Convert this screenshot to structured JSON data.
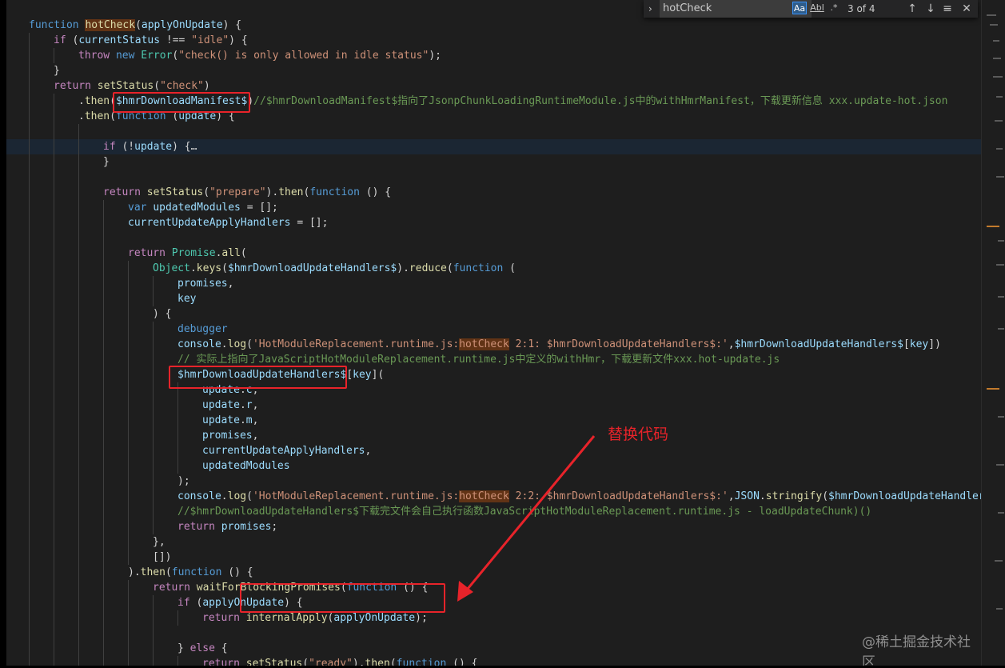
{
  "find_widget": {
    "query": "hotCheck",
    "match_case_label": "Aa",
    "whole_word_label": "Abl",
    "regex_label": ".*",
    "match_count": "3 of 4",
    "prev_icon": "arrow-up-icon",
    "next_icon": "arrow-down-icon",
    "selection_icon": "find-in-selection-icon",
    "close_icon": "close-icon"
  },
  "annotation": {
    "label": "替换代码",
    "color": "#e8232a"
  },
  "watermark": "@稀土掘金技术社区",
  "colors": {
    "editor_bg": "#1e1e1e",
    "keyword": "#569cd6",
    "control": "#c586c0",
    "function": "#dcdcaa",
    "variable": "#9cdcfe",
    "string": "#ce9178",
    "type": "#4ec9b0",
    "comment": "#6a9955",
    "find_highlight": "#613315",
    "annotation_red": "#e8232a"
  },
  "code_lines": [
    {
      "indent": 0,
      "tokens": [
        [
          "kw",
          "function "
        ],
        [
          "fn hl",
          "hotCheck"
        ],
        [
          "pun",
          "("
        ],
        [
          "var",
          "applyOnUpdate"
        ],
        [
          "pun",
          ") {"
        ]
      ]
    },
    {
      "indent": 1,
      "tokens": [
        [
          "ctl",
          "if "
        ],
        [
          "pun",
          "("
        ],
        [
          "var",
          "currentStatus"
        ],
        [
          "pun",
          " !== "
        ],
        [
          "str",
          "\"idle\""
        ],
        [
          "pun",
          ") {"
        ]
      ]
    },
    {
      "indent": 2,
      "tokens": [
        [
          "ctl",
          "throw "
        ],
        [
          "kw",
          "new "
        ],
        [
          "cls",
          "Error"
        ],
        [
          "pun",
          "("
        ],
        [
          "str",
          "\"check() is only allowed in idle status\""
        ],
        [
          "pun",
          ");"
        ]
      ]
    },
    {
      "indent": 1,
      "tokens": [
        [
          "pun",
          "}"
        ]
      ]
    },
    {
      "indent": 1,
      "tokens": [
        [
          "ctl",
          "return "
        ],
        [
          "fn",
          "setStatus"
        ],
        [
          "pun",
          "("
        ],
        [
          "str",
          "\"check\""
        ],
        [
          "pun",
          ")"
        ]
      ]
    },
    {
      "indent": 2,
      "tokens": [
        [
          "pun",
          "."
        ],
        [
          "fn",
          "then"
        ],
        [
          "pun",
          "("
        ],
        [
          "var",
          "$hmrDownloadManifest$"
        ],
        [
          "pun",
          ")"
        ],
        [
          "cmt",
          "//$hmrDownloadManifest$指向了JsonpChunkLoadingRuntimeModule.js中的withHmrManifest，下载更新信息 xxx.update-hot.json"
        ]
      ]
    },
    {
      "indent": 2,
      "tokens": [
        [
          "pun",
          "."
        ],
        [
          "fn",
          "then"
        ],
        [
          "pun",
          "("
        ],
        [
          "kw",
          "function "
        ],
        [
          "pun",
          "("
        ],
        [
          "var",
          "update"
        ],
        [
          "pun",
          ") {"
        ]
      ]
    },
    {
      "indent": 3,
      "tokens": []
    },
    {
      "indent": 3,
      "cur": true,
      "tokens": [
        [
          "ctl",
          "if "
        ],
        [
          "pun",
          "(!"
        ],
        [
          "var",
          "update"
        ],
        [
          "pun",
          ") {…"
        ]
      ]
    },
    {
      "indent": 3,
      "tokens": [
        [
          "pun",
          "}"
        ]
      ]
    },
    {
      "indent": 3,
      "tokens": []
    },
    {
      "indent": 3,
      "tokens": [
        [
          "ctl",
          "return "
        ],
        [
          "fn",
          "setStatus"
        ],
        [
          "pun",
          "("
        ],
        [
          "str",
          "\"prepare\""
        ],
        [
          "pun",
          ")."
        ],
        [
          "fn",
          "then"
        ],
        [
          "pun",
          "("
        ],
        [
          "kw",
          "function "
        ],
        [
          "pun",
          "() {"
        ]
      ]
    },
    {
      "indent": 4,
      "tokens": [
        [
          "kw",
          "var "
        ],
        [
          "var",
          "updatedModules"
        ],
        [
          "pun",
          " = [];"
        ]
      ]
    },
    {
      "indent": 4,
      "tokens": [
        [
          "var",
          "currentUpdateApplyHandlers"
        ],
        [
          "pun",
          " = [];"
        ]
      ]
    },
    {
      "indent": 4,
      "tokens": []
    },
    {
      "indent": 4,
      "tokens": [
        [
          "ctl",
          "return "
        ],
        [
          "cls",
          "Promise"
        ],
        [
          "pun",
          "."
        ],
        [
          "fn",
          "all"
        ],
        [
          "pun",
          "("
        ]
      ]
    },
    {
      "indent": 5,
      "tokens": [
        [
          "cls",
          "Object"
        ],
        [
          "pun",
          "."
        ],
        [
          "fn",
          "keys"
        ],
        [
          "pun",
          "("
        ],
        [
          "var",
          "$hmrDownloadUpdateHandlers$"
        ],
        [
          "pun",
          ")."
        ],
        [
          "fn",
          "reduce"
        ],
        [
          "pun",
          "("
        ],
        [
          "kw",
          "function "
        ],
        [
          "pun",
          "("
        ]
      ]
    },
    {
      "indent": 6,
      "tokens": [
        [
          "var",
          "promises"
        ],
        [
          "pun",
          ","
        ]
      ]
    },
    {
      "indent": 6,
      "tokens": [
        [
          "var",
          "key"
        ]
      ]
    },
    {
      "indent": 5,
      "tokens": [
        [
          "pun",
          ") {"
        ]
      ]
    },
    {
      "indent": 6,
      "tokens": [
        [
          "kw",
          "debugger"
        ]
      ]
    },
    {
      "indent": 6,
      "tokens": [
        [
          "var",
          "console"
        ],
        [
          "pun",
          "."
        ],
        [
          "fn",
          "log"
        ],
        [
          "pun",
          "("
        ],
        [
          "str",
          "'HotModuleReplacement.runtime.js:"
        ],
        [
          "str hl",
          "hotCheck"
        ],
        [
          "str",
          " 2:1: $hmrDownloadUpdateHandlers$:'"
        ],
        [
          "pun",
          ","
        ],
        [
          "var",
          "$hmrDownloadUpdateHandlers$"
        ],
        [
          "pun",
          "["
        ],
        [
          "var",
          "key"
        ],
        [
          "pun",
          "])"
        ]
      ]
    },
    {
      "indent": 6,
      "tokens": [
        [
          "cmt",
          "// 实际上指向了JavaScriptHotModuleReplacement.runtime.js中定义的withHmr，下载更新文件xxx.hot-update.js"
        ]
      ]
    },
    {
      "indent": 6,
      "tokens": [
        [
          "var",
          "$hmrDownloadUpdateHandlers$"
        ],
        [
          "pun",
          "["
        ],
        [
          "var",
          "key"
        ],
        [
          "pun",
          "]("
        ]
      ]
    },
    {
      "indent": 7,
      "tokens": [
        [
          "var",
          "update"
        ],
        [
          "pun",
          "."
        ],
        [
          "var",
          "c"
        ],
        [
          "pun",
          ","
        ]
      ]
    },
    {
      "indent": 7,
      "tokens": [
        [
          "var",
          "update"
        ],
        [
          "pun",
          "."
        ],
        [
          "var",
          "r"
        ],
        [
          "pun",
          ","
        ]
      ]
    },
    {
      "indent": 7,
      "tokens": [
        [
          "var",
          "update"
        ],
        [
          "pun",
          "."
        ],
        [
          "var",
          "m"
        ],
        [
          "pun",
          ","
        ]
      ]
    },
    {
      "indent": 7,
      "tokens": [
        [
          "var",
          "promises"
        ],
        [
          "pun",
          ","
        ]
      ]
    },
    {
      "indent": 7,
      "tokens": [
        [
          "var",
          "currentUpdateApplyHandlers"
        ],
        [
          "pun",
          ","
        ]
      ]
    },
    {
      "indent": 7,
      "tokens": [
        [
          "var",
          "updatedModules"
        ]
      ]
    },
    {
      "indent": 6,
      "tokens": [
        [
          "pun",
          ");"
        ]
      ]
    },
    {
      "indent": 6,
      "tokens": [
        [
          "var",
          "console"
        ],
        [
          "pun",
          "."
        ],
        [
          "fn",
          "log"
        ],
        [
          "pun",
          "("
        ],
        [
          "str",
          "'HotModuleReplacement.runtime.js:"
        ],
        [
          "str hl",
          "hotCheck"
        ],
        [
          "str",
          " 2:2: $hmrDownloadUpdateHandlers$:'"
        ],
        [
          "pun",
          ","
        ],
        [
          "var",
          "JSON"
        ],
        [
          "pun",
          "."
        ],
        [
          "fn",
          "stringify"
        ],
        [
          "pun",
          "("
        ],
        [
          "var",
          "$hmrDownloadUpdateHandlers$"
        ]
      ]
    },
    {
      "indent": 6,
      "tokens": [
        [
          "cmt",
          "//$hmrDownloadUpdateHandlers$下载完文件会自己执行函数JavaScriptHotModuleReplacement.runtime.js - loadUpdateChunk)()"
        ]
      ]
    },
    {
      "indent": 6,
      "tokens": [
        [
          "ctl",
          "return "
        ],
        [
          "var",
          "promises"
        ],
        [
          "pun",
          ";"
        ]
      ]
    },
    {
      "indent": 5,
      "tokens": [
        [
          "pun",
          "},"
        ]
      ]
    },
    {
      "indent": 5,
      "tokens": [
        [
          "pun",
          "[])"
        ]
      ]
    },
    {
      "indent": 4,
      "tokens": [
        [
          "pun",
          ")."
        ],
        [
          "fn",
          "then"
        ],
        [
          "pun",
          "("
        ],
        [
          "kw",
          "function "
        ],
        [
          "pun",
          "() {"
        ]
      ]
    },
    {
      "indent": 5,
      "tokens": [
        [
          "ctl",
          "return "
        ],
        [
          "fn",
          "waitForBlockingPromises"
        ],
        [
          "pun",
          "("
        ],
        [
          "kw",
          "function "
        ],
        [
          "pun",
          "() {"
        ]
      ]
    },
    {
      "indent": 6,
      "tokens": [
        [
          "ctl",
          "if "
        ],
        [
          "pun",
          "("
        ],
        [
          "var",
          "applyOnUpdate"
        ],
        [
          "pun",
          ") {"
        ]
      ]
    },
    {
      "indent": 7,
      "tokens": [
        [
          "ctl",
          "return "
        ],
        [
          "fn",
          "internalApply"
        ],
        [
          "pun",
          "("
        ],
        [
          "var",
          "applyOnUpdate"
        ],
        [
          "pun",
          ");"
        ]
      ]
    },
    {
      "indent": 6,
      "tokens": []
    },
    {
      "indent": 6,
      "tokens": [
        [
          "pun",
          "} "
        ],
        [
          "ctl",
          "else "
        ],
        [
          "pun",
          "{"
        ]
      ]
    },
    {
      "indent": 7,
      "tokens": [
        [
          "ctl",
          "return "
        ],
        [
          "fn",
          "setStatus"
        ],
        [
          "pun",
          "("
        ],
        [
          "str",
          "\"ready\""
        ],
        [
          "pun",
          ")."
        ],
        [
          "fn",
          "then"
        ],
        [
          "pun",
          "("
        ],
        [
          "kw",
          "function "
        ],
        [
          "pun",
          "() {"
        ]
      ]
    }
  ]
}
